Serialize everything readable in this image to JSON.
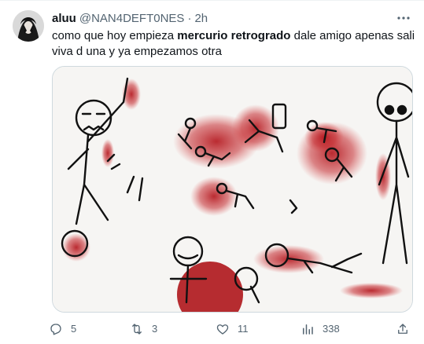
{
  "tweet": {
    "author_name": "aluu",
    "handle": "@NAN4DEFT0NES",
    "separator": "·",
    "time": "2h",
    "text_before": "como que hoy empieza ",
    "text_bold": "mercurio retrogrado",
    "text_after": " dale amigo apenas sali viva d una y ya empezamos otra"
  },
  "actions": {
    "replies": "5",
    "retweets": "3",
    "likes": "11",
    "views": "338"
  },
  "icons": {
    "more": "more-horizontal-icon",
    "reply": "reply-icon",
    "retweet": "retweet-icon",
    "like": "heart-icon",
    "views": "views-chart-icon",
    "share": "share-icon"
  },
  "colors": {
    "text": "#0f1419",
    "secondary": "#536471",
    "border": "#cfd9de",
    "blood": "#b3141b"
  }
}
